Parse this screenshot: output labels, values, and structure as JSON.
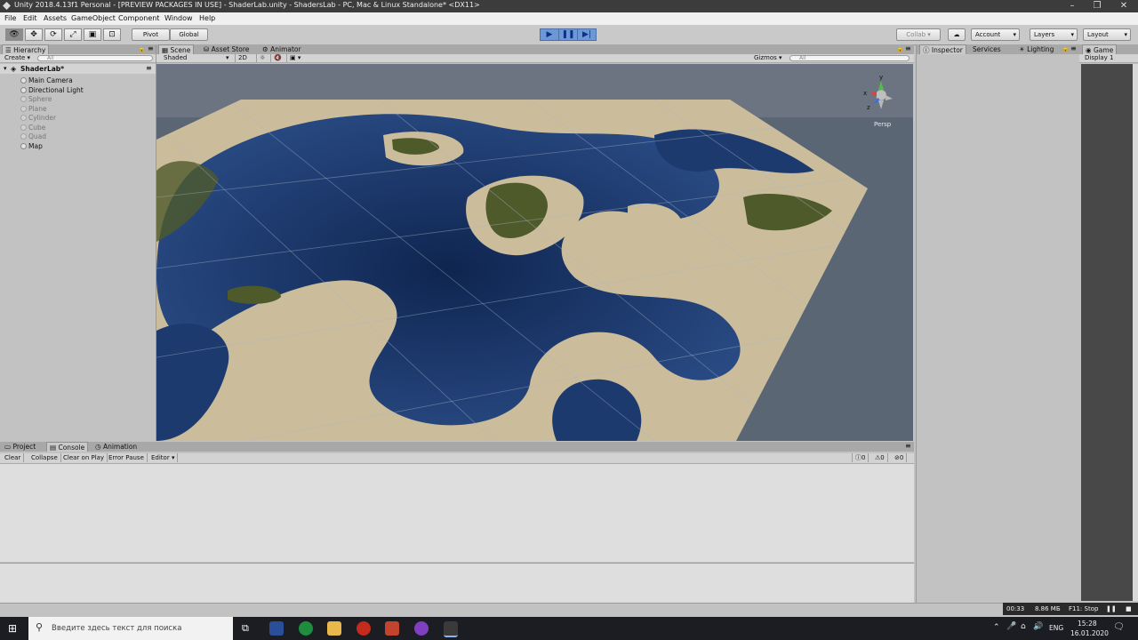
{
  "window": {
    "title": "Unity 2018.4.13f1 Personal - [PREVIEW PACKAGES IN USE] - ShaderLab.unity - ShadersLab - PC, Mac & Linux Standalone* <DX11>"
  },
  "menu": [
    "File",
    "Edit",
    "Assets",
    "GameObject",
    "Component",
    "Window",
    "Help"
  ],
  "toolbar": {
    "pivot": "Pivot",
    "global": "Global",
    "collab": "Collab ▾",
    "account": "Account",
    "layers": "Layers",
    "layout": "Layout"
  },
  "hierarchy": {
    "tab": "Hierarchy",
    "create": "Create ▾",
    "search_placeholder": "All",
    "scene_name": "ShaderLab*",
    "items": [
      {
        "label": "Main Camera",
        "active": true
      },
      {
        "label": "Directional Light",
        "active": true
      },
      {
        "label": "Sphere",
        "active": false
      },
      {
        "label": "Plane",
        "active": false
      },
      {
        "label": "Cylinder",
        "active": false
      },
      {
        "label": "Cube",
        "active": false
      },
      {
        "label": "Quad",
        "active": false
      },
      {
        "label": "Map",
        "active": true
      }
    ]
  },
  "scene": {
    "tabs": [
      "Scene",
      "Asset Store",
      "Animator"
    ],
    "shading": "Shaded",
    "mode_2d": "2D",
    "gizmos": "Gizmos ▾",
    "search_placeholder": "All",
    "persp": "Persp",
    "gizmo_axes": {
      "x": "x",
      "y": "y",
      "z": "z"
    }
  },
  "inspector": {
    "tabs": [
      "Inspector",
      "Services",
      "Lighting"
    ]
  },
  "game": {
    "tab": "Game",
    "display": "Display 1"
  },
  "console": {
    "tabs": [
      "Project",
      "Console",
      "Animation"
    ],
    "buttons": [
      "Clear",
      "Collapse",
      "Clear on Play",
      "Error Pause",
      "Editor ▾"
    ],
    "counts": {
      "logs": "0",
      "warnings": "0",
      "errors": "0"
    }
  },
  "recorder": {
    "time": "00:33",
    "size": "8.86 МБ",
    "stop": "F11: Stop"
  },
  "taskbar": {
    "search_placeholder": "Введите здесь текст для поиска",
    "lang": "ENG",
    "time": "15:28",
    "date": "16.01.2020"
  },
  "colors": {
    "water": "#1d3a6e",
    "sand": "#cbbd9c",
    "grass": "#4f5a2b",
    "accent": "#6d98d8"
  }
}
